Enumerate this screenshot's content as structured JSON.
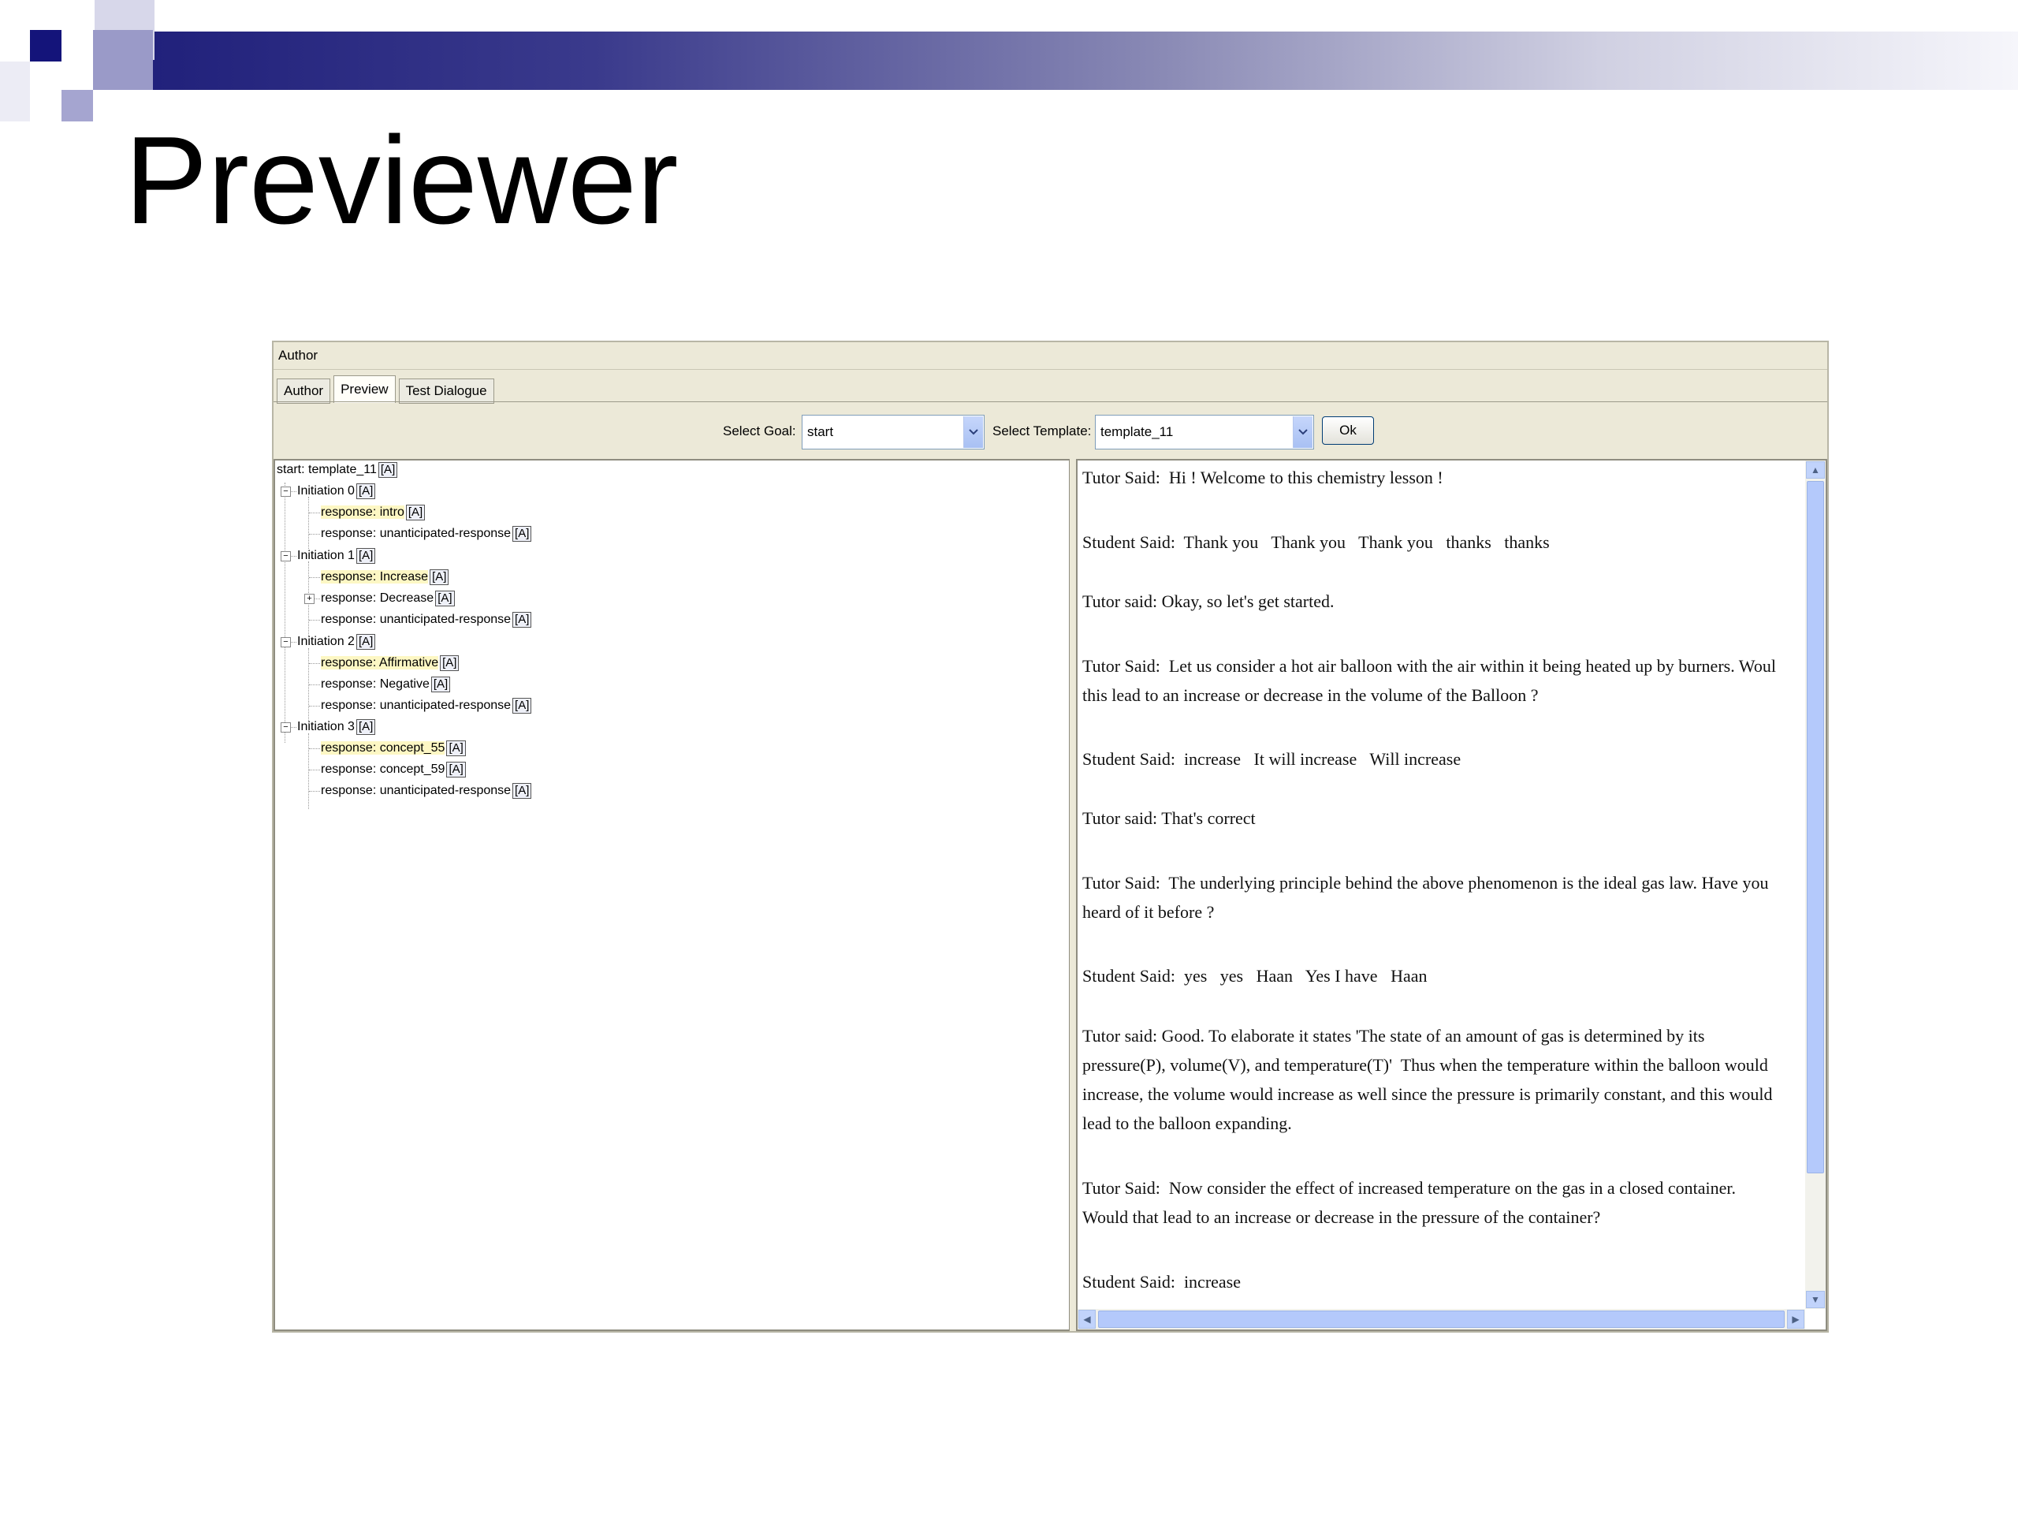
{
  "slide": {
    "title": "Previewer",
    "colors": {
      "accent_dark": "#1f1f7a",
      "accent_light": "#d0d0e2"
    }
  },
  "app": {
    "window_title": "Author",
    "tabs": [
      {
        "label": "Author",
        "active": false
      },
      {
        "label": "Preview",
        "active": true
      },
      {
        "label": "Test Dialogue",
        "active": false
      }
    ],
    "toolbar": {
      "goal_label": "Select Goal:",
      "goal_value": "start",
      "template_label": "Select Template:",
      "template_value": "template_11",
      "ok_label": "Ok"
    },
    "tree": {
      "root": "start: template_11",
      "action_label": "[A]",
      "expand_glyph": "+",
      "collapse_glyph": "−",
      "initiations": [
        {
          "label": "Initiation 0",
          "responses": [
            "response: intro",
            "response: unanticipated-response"
          ]
        },
        {
          "label": "Initiation 1",
          "responses": [
            "response: Increase",
            "response: Decrease",
            "response: unanticipated-response"
          ]
        },
        {
          "label": "Initiation 2",
          "responses": [
            "response: Affirmative",
            "response: Negative",
            "response: unanticipated-response"
          ]
        },
        {
          "label": "Initiation 3",
          "responses": [
            "response: concept_55",
            "response: concept_59",
            "response: unanticipated-response"
          ]
        }
      ]
    },
    "dialogue": [
      "Tutor Said:  Hi ! Welcome to this chemistry lesson !",
      "Student Said:  Thank you   Thank you   Thank you   thanks   thanks",
      "Tutor said: Okay, so let's get started.",
      "Tutor Said:  Let us consider a hot air balloon with the air within it being heated up by burners. Woul",
      "this lead to an increase or decrease in the volume of the Balloon ?",
      "Student Said:  increase   It will increase   Will increase",
      "Tutor said: That's correct",
      "Tutor Said:  The underlying principle behind the above phenomenon is the ideal gas law. Have you",
      "heard of it before ?",
      "Student Said:  yes   yes   Haan   Yes I have   Haan",
      "Tutor said: Good. To elaborate it states 'The state of an amount of gas is determined by its",
      "pressure(P), volume(V), and temperature(T)'  Thus when the temperature within the balloon would",
      "increase, the volume would increase as well since the pressure is primarily constant, and this would",
      "lead to the balloon expanding.",
      "Tutor Said:  Now consider the effect of increased temperature on the gas in a closed container.",
      "Would that lead to an increase or decrease in the pressure of the container?",
      "Student Said:  increase"
    ],
    "scroll_glyphs": {
      "up": "▲",
      "down": "▼",
      "left": "◀",
      "right": "▶"
    }
  }
}
